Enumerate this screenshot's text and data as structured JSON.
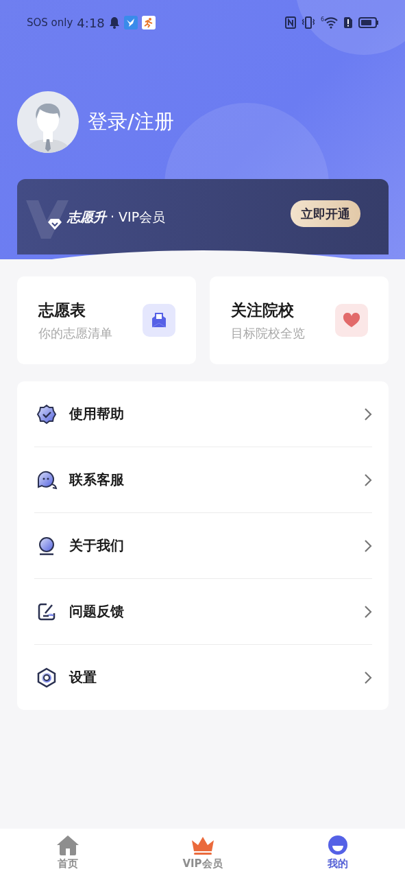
{
  "status_bar": {
    "carrier": "SOS only",
    "time": "4:18",
    "wifi_label": "6"
  },
  "profile": {
    "login": "登录/注册"
  },
  "vip": {
    "brand": "志愿升",
    "label": "· VIP会员",
    "button": "立即开通"
  },
  "quick_cards": [
    {
      "title": "志愿表",
      "subtitle": "你的志愿清单"
    },
    {
      "title": "关注院校",
      "subtitle": "目标院校全览"
    }
  ],
  "menu": [
    {
      "label": "使用帮助"
    },
    {
      "label": "联系客服"
    },
    {
      "label": "关于我们"
    },
    {
      "label": "问题反馈"
    },
    {
      "label": "设置"
    }
  ],
  "tab_bar": [
    {
      "label": "首页",
      "selected": false
    },
    {
      "label": "VIP会员",
      "selected": false
    },
    {
      "label": "我的",
      "selected": true
    }
  ]
}
